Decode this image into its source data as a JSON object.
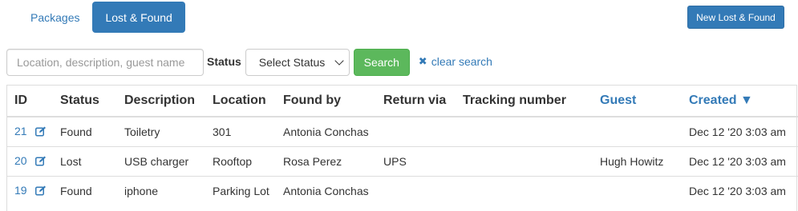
{
  "tabs": [
    {
      "label": "Packages",
      "active": false
    },
    {
      "label": "Lost & Found",
      "active": true
    }
  ],
  "new_button_label": "New Lost & Found",
  "search": {
    "placeholder": "Location, description, guest name",
    "value": "",
    "status_label": "Status",
    "status_selected": "Select Status",
    "search_label": "Search",
    "clear_label": "clear search"
  },
  "table": {
    "headers": {
      "id": "ID",
      "status": "Status",
      "description": "Description",
      "location": "Location",
      "found_by": "Found by",
      "return_via": "Return via",
      "tracking": "Tracking number",
      "guest": "Guest",
      "created": "Created ▼"
    },
    "rows": [
      {
        "id": "21",
        "status": "Found",
        "description": "Toiletry",
        "location": "301",
        "found_by": "Antonia Conchas",
        "return_via": "",
        "tracking": "",
        "guest": "",
        "created": "Dec 12 '20 3:03 am"
      },
      {
        "id": "20",
        "status": "Lost",
        "description": "USB charger",
        "location": "Rooftop",
        "found_by": "Rosa Perez",
        "return_via": "UPS",
        "tracking": "",
        "guest": "Hugh Howitz",
        "created": "Dec 12 '20 3:03 am"
      },
      {
        "id": "19",
        "status": "Found",
        "description": "iphone",
        "location": "Parking Lot",
        "found_by": "Antonia Conchas",
        "return_via": "",
        "tracking": "",
        "guest": "",
        "created": "Dec 12 '20 3:03 am"
      }
    ]
  },
  "colors": {
    "primary": "#337ab7",
    "success": "#5cb85c",
    "border": "#dddddd",
    "text": "#333333"
  }
}
